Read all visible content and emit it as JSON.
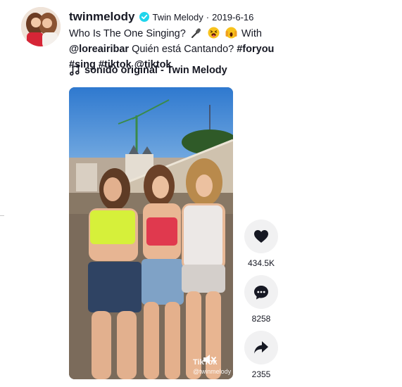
{
  "post": {
    "username": "twinmelody",
    "nickname": "Twin Melody",
    "separator": "·",
    "date": "2019-6-16",
    "caption": {
      "text_1": "Who Is The One Singing?",
      "text_2": "With",
      "mention_1": "@loreairibar",
      "text_3": "Quién está Cantando?",
      "hashtag_1": "#foryou",
      "hashtag_2": "#sing",
      "hashtag_3": "#tiktok",
      "mention_2": "@tiktok"
    },
    "sound": "sonido original - Twin Melody"
  },
  "video": {
    "watermark_logo": "TikTok",
    "watermark_handle": "@twinmelody"
  },
  "actions": {
    "likes": "434.5K",
    "comments": "8258",
    "shares": "2355"
  },
  "colors": {
    "verified": "#20d5ec",
    "action_bg": "#f1f1f2",
    "text": "#161823"
  }
}
